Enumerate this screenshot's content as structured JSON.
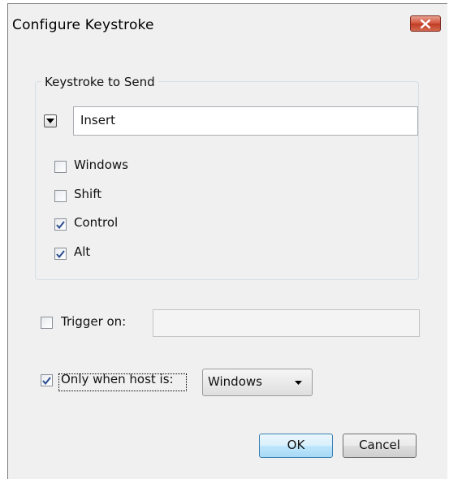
{
  "dialog": {
    "title": "Configure Keystroke"
  },
  "keystroke_group": {
    "legend": "Keystroke to Send",
    "key_value": "Insert",
    "modifiers": [
      {
        "label": "Windows",
        "checked": false
      },
      {
        "label": "Shift",
        "checked": false
      },
      {
        "label": "Control",
        "checked": true
      },
      {
        "label": "Alt",
        "checked": true
      }
    ]
  },
  "trigger": {
    "label": "Trigger on:",
    "checked": false,
    "value": ""
  },
  "host_filter": {
    "label": "Only when host is:",
    "checked": true,
    "selected": "Windows"
  },
  "buttons": {
    "ok": "OK",
    "cancel": "Cancel"
  },
  "colors": {
    "dialog_bg": "#f0f0f0",
    "close_button": "#c94a30",
    "check_mark": "#2b4d8f",
    "ok_button_border": "#3c7fb1"
  },
  "icons": {
    "close": "close-icon",
    "key_dropdown": "triangle-down-icon",
    "checkmark": "checkmark-icon",
    "select_arrow": "chevron-down-icon"
  }
}
